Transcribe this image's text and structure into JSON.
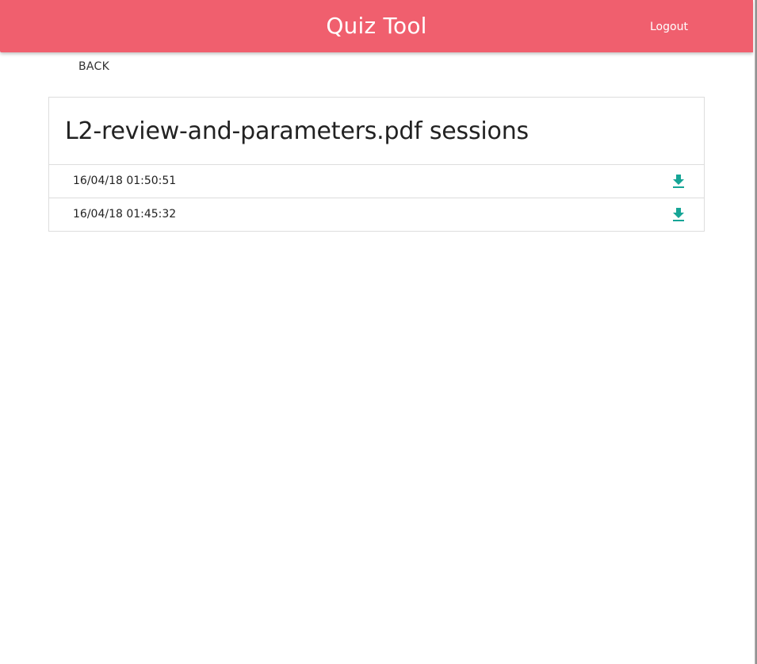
{
  "header": {
    "title": "Quiz Tool",
    "logout_label": "Logout",
    "background_color": "#f05f6e"
  },
  "nav": {
    "back_label": "BACK"
  },
  "card": {
    "title": "L2-review-and-parameters.pdf sessions",
    "sessions": [
      {
        "timestamp": "16/04/18 01:50:51",
        "action_icon": "download-icon"
      },
      {
        "timestamp": "16/04/18 01:45:32",
        "action_icon": "download-icon"
      }
    ]
  },
  "colors": {
    "accent": "#16a596",
    "border": "#dddddd"
  }
}
